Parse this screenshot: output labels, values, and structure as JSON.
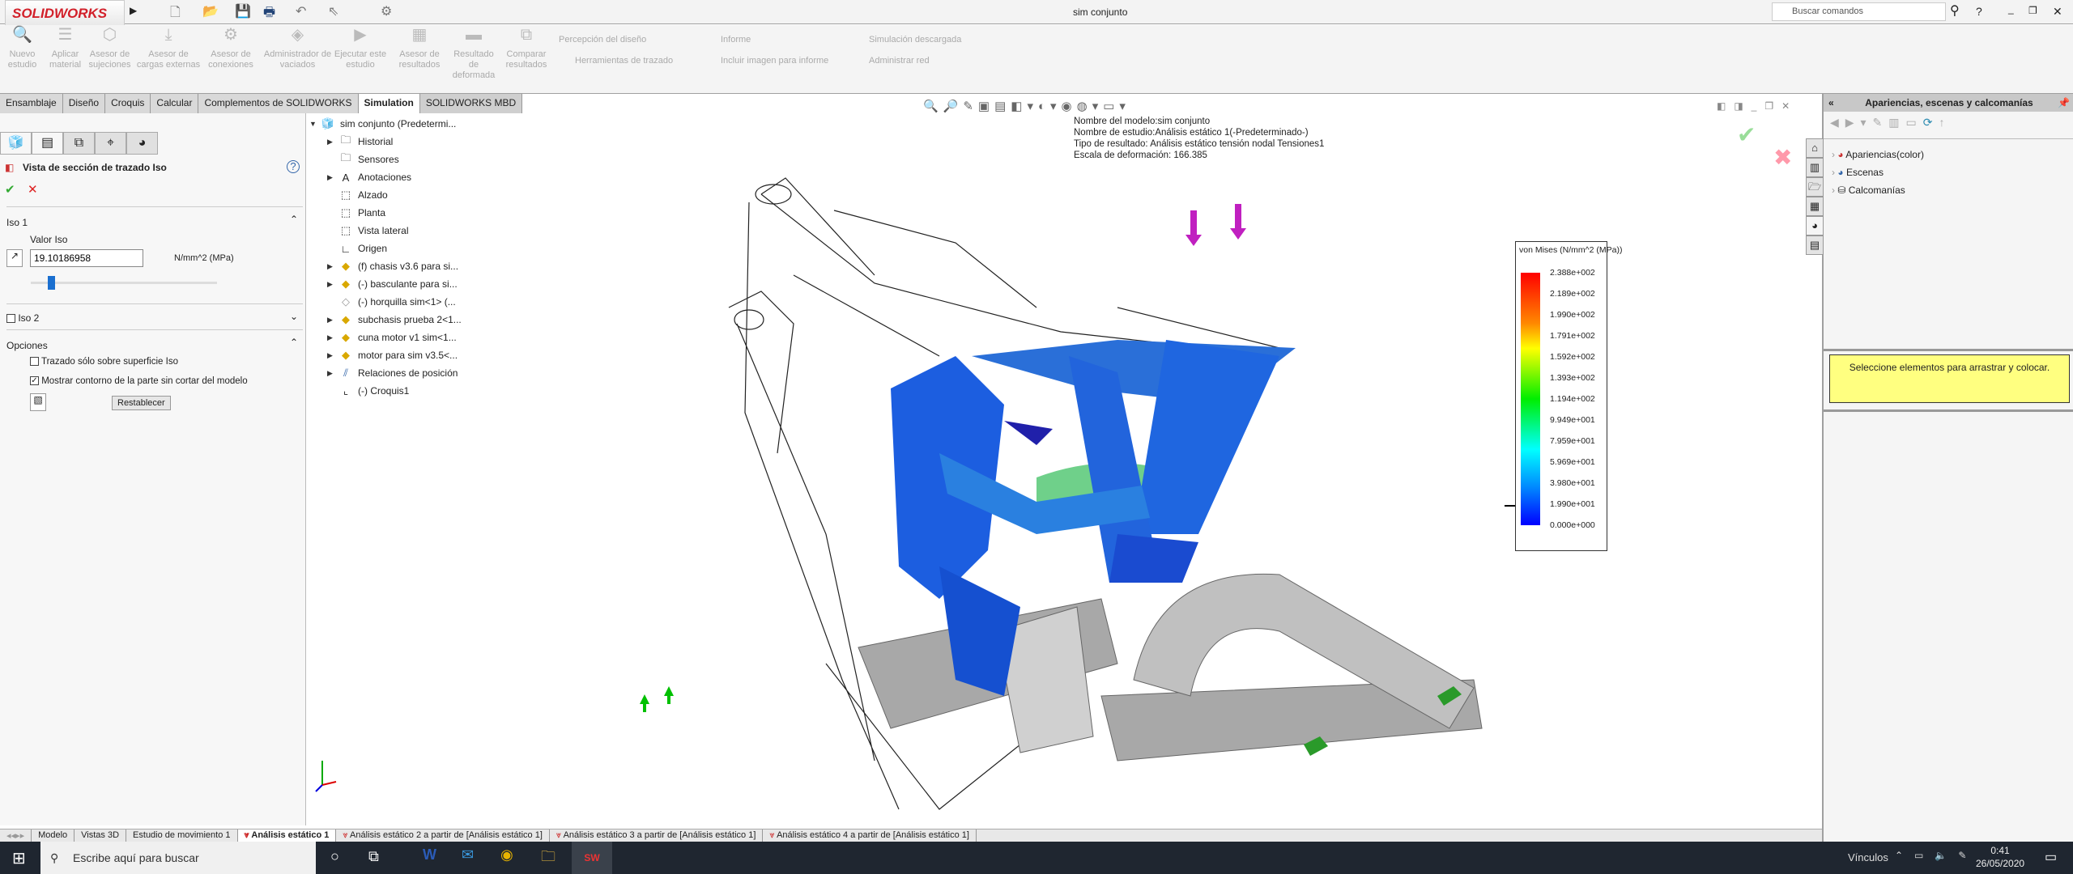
{
  "app": {
    "logo": "SOLIDWORKS",
    "title": "sim conjunto",
    "search_placeholder": "Buscar comandos"
  },
  "ribbon": {
    "buttons": [
      "Nuevo estudio",
      "Aplicar material",
      "Asesor de sujeciones",
      "Asesor de cargas externas",
      "Asesor de conexiones",
      "Administrador de vaciados",
      "Ejecutar este estudio",
      "Asesor de resultados",
      "Resultado de deformada",
      "Comparar resultados"
    ],
    "small": [
      "Percepción del diseño",
      "Herramientas de trazado",
      "Informe",
      "Incluir imagen para informe",
      "Simulación descargada",
      "Administrar red"
    ]
  },
  "command_tabs": [
    "Ensamblaje",
    "Diseño",
    "Croquis",
    "Calcular",
    "Complementos de SOLIDWORKS",
    "Simulation",
    "SOLIDWORKS MBD"
  ],
  "property_manager": {
    "title": "Vista de sección de trazado Iso",
    "iso1": "Iso 1",
    "valor_label": "Valor Iso",
    "valor": "19.10186958",
    "unit": "N/mm^2 (MPa)",
    "slider_fraction": 0.08,
    "iso2": "Iso 2",
    "opciones": "Opciones",
    "opt1": "Trazado sólo sobre superficie Iso",
    "opt1_checked": false,
    "opt2": "Mostrar contorno de la parte sin cortar del modelo",
    "opt2_checked": true,
    "reset": "Restablecer"
  },
  "tree": [
    "sim conjunto  (Predetermi...",
    "Historial",
    "Sensores",
    "Anotaciones",
    "Alzado",
    "Planta",
    "Vista lateral",
    "Origen",
    "(f) chasis v3.6 para si...",
    "(-) basculante para si...",
    "(-) horquilla sim<1> (...",
    "subchasis prueba 2<1...",
    "cuna motor v1 sim<1...",
    "motor para sim v3.5<...",
    "Relaciones de posición",
    "(-) Croquis1"
  ],
  "info": [
    "Nombre del modelo:sim conjunto",
    "Nombre de estudio:Análisis estático 1(-Predeterminado-)",
    "Tipo de resultado: Análisis estático tensión nodal Tensiones1",
    "Escala de deformación: 166.385"
  ],
  "legend": {
    "title": "von Mises (N/mm^2 (MPa))",
    "ticks": [
      "2.388e+002",
      "2.189e+002",
      "1.990e+002",
      "1.791e+002",
      "1.592e+002",
      "1.393e+002",
      "1.194e+002",
      "9.949e+001",
      "7.959e+001",
      "5.969e+001",
      "3.980e+001",
      "1.990e+001",
      "0.000e+000"
    ]
  },
  "task_pane": {
    "title": "Apariencias, escenas y calcomanías",
    "items": [
      "Apariencias(color)",
      "Escenas",
      "Calcomanías"
    ],
    "hint": "Seleccione elementos para arrastrar y colocar."
  },
  "doc_tabs": [
    "Modelo",
    "Vistas 3D",
    "Estudio de movimiento 1",
    "Análisis estático 1",
    "Análisis estático 2 a partir de [Análisis estático 1]",
    "Análisis estático 3 a partir de [Análisis estático 1]",
    "Análisis estático 4 a partir de [Análisis estático 1]"
  ],
  "taskbar": {
    "search": "Escribe aquí para buscar",
    "links": "Vínculos",
    "time": "0:41",
    "date": "26/05/2020"
  }
}
